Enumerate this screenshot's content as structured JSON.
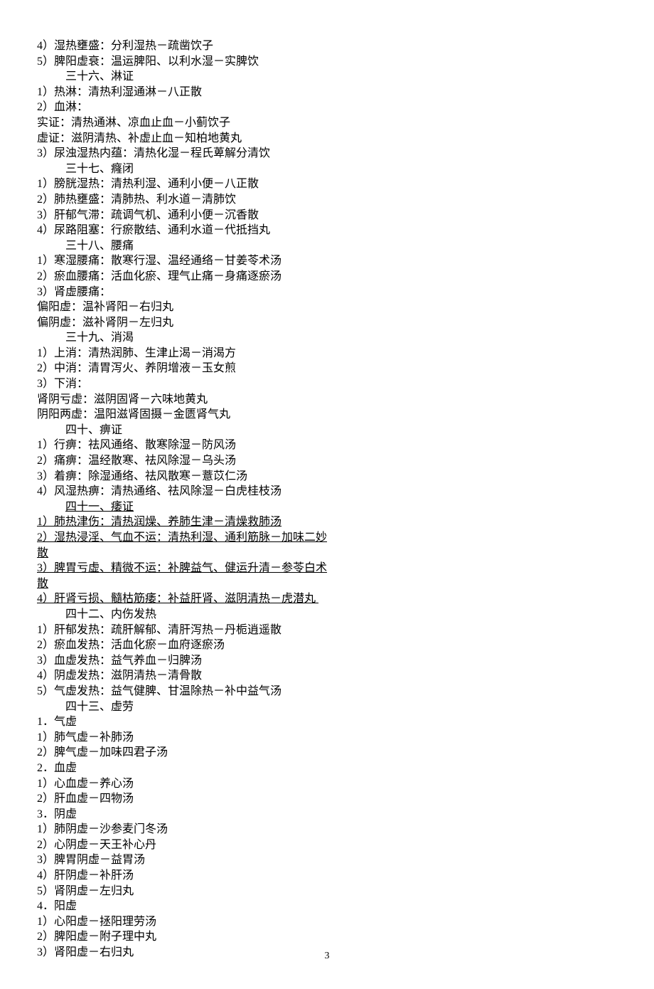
{
  "page_number": "3",
  "lines": [
    {
      "text": "4）湿热壅盛：分利湿热－疏凿饮子"
    },
    {
      "text": "5）脾阳虚衰：温运脾阳、以利水湿－实脾饮"
    },
    {
      "heading": true,
      "text": "三十六、淋证"
    },
    {
      "text": "1）热淋：清热利湿通淋－八正散"
    },
    {
      "text": "2）血淋："
    },
    {
      "text": "实证：清热通淋、凉血止血－小蓟饮子"
    },
    {
      "text": "虚证：滋阴清热、补虚止血－知柏地黄丸"
    },
    {
      "text": "3）尿浊湿热内蕴：清热化湿－程氏萆解分清饮"
    },
    {
      "heading": true,
      "text": "三十七、癃闭"
    },
    {
      "text": "1）膀胱湿热：清热利湿、通利小便－八正散"
    },
    {
      "text": "2）肺热壅盛：清肺热、利水道－清肺饮"
    },
    {
      "text": "3）肝郁气滞：疏调气机、通利小便－沉香散"
    },
    {
      "text": "4）尿路阻塞：行瘀散结、通利水道－代抵挡丸"
    },
    {
      "heading": true,
      "text": "三十八、腰痛"
    },
    {
      "text": "1）寒湿腰痛：散寒行湿、温经通络－甘姜苓术汤"
    },
    {
      "text": "2）瘀血腰痛：活血化瘀、理气止痛－身痛逐瘀汤"
    },
    {
      "text": "3）肾虚腰痛："
    },
    {
      "text": "偏阳虚：温补肾阳－右归丸"
    },
    {
      "text": "偏阴虚：滋补肾阴－左归丸"
    },
    {
      "heading": true,
      "text": "三十九、消渴"
    },
    {
      "text": "1）上消：清热润肺、生津止渴－消渴方"
    },
    {
      "text": "2）中消：清胃泻火、养阴增液－玉女煎"
    },
    {
      "text": "3）下消："
    },
    {
      "text": "肾阴亏虚：滋阴固肾－六味地黄丸"
    },
    {
      "text": "阴阳两虚：温阳滋肾固摄－金匮肾气丸"
    },
    {
      "heading": true,
      "text": "四十、痹证"
    },
    {
      "text": "1）行痹：祛风通络、散寒除湿－防风汤"
    },
    {
      "text": "2）痛痹：温经散寒、祛风除湿－乌头汤"
    },
    {
      "text": "3）着痹：除湿通络、祛风散寒－薏苡仁汤"
    },
    {
      "text": "4）风湿热痹：清热通络、祛风除湿－白虎桂枝汤"
    },
    {
      "heading": true,
      "under": true,
      "text": "四十一、痿证"
    },
    {
      "under": true,
      "text": "1）肺热津伤：清热润燥、养肺生津－清燥救肺汤"
    },
    {
      "under": true,
      "text": "2）湿热浸淫、气血不运：清热利湿、通利筋脉－加味二妙"
    },
    {
      "under": true,
      "text": "散"
    },
    {
      "under": true,
      "text": "3）脾胃亏虚、精微不运：补脾益气、健运升清－参苓白术"
    },
    {
      "under": true,
      "text": "散"
    },
    {
      "under": true,
      "text": "4）肝肾亏损、髓枯筋痿：补益肝肾、滋阴清热－虎潜丸 "
    },
    {
      "heading": true,
      "text": "四十二、内伤发热"
    },
    {
      "text": "1）肝郁发热：疏肝解郁、清肝泻热－丹栀逍遥散"
    },
    {
      "text": "2）瘀血发热：活血化瘀－血府逐瘀汤"
    },
    {
      "text": "3）血虚发热：益气养血－归脾汤"
    },
    {
      "text": "4）阴虚发热：滋阴清热－清骨散"
    },
    {
      "text": "5）气虚发热：益气健脾、甘温除热－补中益气汤"
    },
    {
      "heading": true,
      "text": "四十三、虚劳"
    },
    {
      "text": "1．气虚"
    },
    {
      "text": "1）肺气虚－补肺汤"
    },
    {
      "text": "2）脾气虚－加味四君子汤"
    },
    {
      "text": "2．血虚"
    },
    {
      "text": "1）心血虚－养心汤"
    },
    {
      "text": "2）肝血虚－四物汤"
    },
    {
      "text": "3．阴虚"
    },
    {
      "text": "1）肺阴虚－沙参麦门冬汤"
    },
    {
      "text": "2）心阴虚－天王补心丹"
    },
    {
      "text": "3）脾胃阴虚－益胃汤"
    },
    {
      "text": "4）肝阴虚－补肝汤"
    },
    {
      "text": "5）肾阴虚－左归丸"
    },
    {
      "text": "4．阳虚"
    },
    {
      "text": "1）心阳虚－拯阳理劳汤"
    },
    {
      "text": "2）脾阳虚－附子理中丸"
    },
    {
      "text": "3）肾阳虚－右归丸"
    }
  ]
}
